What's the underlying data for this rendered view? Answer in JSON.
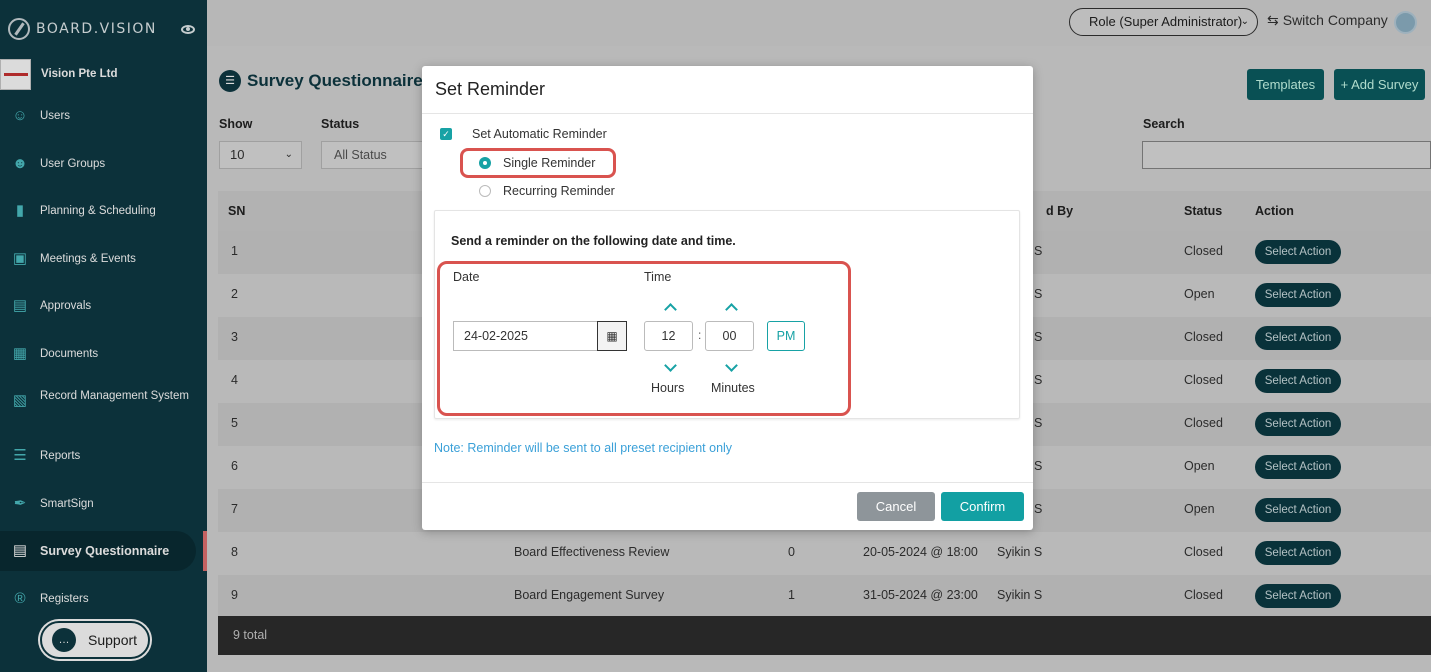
{
  "brand": {
    "name": "BOARD.VISION"
  },
  "company": {
    "name": "Vision Pte Ltd"
  },
  "sidebar": {
    "items": [
      {
        "label": "Users",
        "icon": "user-icon"
      },
      {
        "label": "User Groups",
        "icon": "user-group-icon"
      },
      {
        "label": "Planning & Scheduling",
        "icon": "chart-bars-icon"
      },
      {
        "label": "Meetings & Events",
        "icon": "calendar-icon"
      },
      {
        "label": "Approvals",
        "icon": "approval-doc-icon"
      },
      {
        "label": "Documents",
        "icon": "documents-icon"
      },
      {
        "label": "Record Management System",
        "icon": "record-icon"
      },
      {
        "label": "Reports",
        "icon": "reports-icon"
      },
      {
        "label": "SmartSign",
        "icon": "signature-icon"
      },
      {
        "label": "Survey Questionnaire",
        "icon": "survey-icon",
        "active": true
      },
      {
        "label": "Registers",
        "icon": "registered-icon"
      }
    ],
    "support_label": "Support"
  },
  "header": {
    "role": "Role (Super Administrator)",
    "switch_company": "Switch Company"
  },
  "main": {
    "title": "Survey Questionnaire",
    "templates_label": "Templates",
    "add_label": "+ Add Survey",
    "show_label": "Show",
    "show_value": "10",
    "status_label": "Status",
    "status_value": "All Status",
    "search_label": "Search",
    "columns": {
      "sn": "SN",
      "by": "d By",
      "status": "Status",
      "action": "Action"
    },
    "rows": [
      {
        "sn": "1",
        "name": "",
        "responses": "",
        "date": "",
        "by": "S",
        "status": "Closed"
      },
      {
        "sn": "2",
        "name": "",
        "responses": "",
        "date": "",
        "by": "S",
        "status": "Open"
      },
      {
        "sn": "3",
        "name": "",
        "responses": "",
        "date": "",
        "by": "S",
        "status": "Closed"
      },
      {
        "sn": "4",
        "name": "",
        "responses": "",
        "date": "",
        "by": "S",
        "status": "Closed"
      },
      {
        "sn": "5",
        "name": "",
        "responses": "",
        "date": "",
        "by": "S",
        "status": "Closed"
      },
      {
        "sn": "6",
        "name": "",
        "responses": "",
        "date": "",
        "by": "S",
        "status": "Open"
      },
      {
        "sn": "7",
        "name": "",
        "responses": "",
        "date": "",
        "by": "S",
        "status": "Open"
      },
      {
        "sn": "8",
        "name": "Board Effectiveness Review",
        "responses": "0",
        "date": "20-05-2024 @ 18:00",
        "by": "Syikin S",
        "status": "Closed"
      },
      {
        "sn": "9",
        "name": "Board Engagement Survey",
        "responses": "1",
        "date": "31-05-2024 @ 23:00",
        "by": "Syikin S",
        "status": "Closed"
      }
    ],
    "action_label": "Select Action",
    "total": "9 total"
  },
  "modal": {
    "title": "Set Reminder",
    "auto_reminder_label": "Set Automatic Reminder",
    "single_label": "Single Reminder",
    "recurring_label": "Recurring Reminder",
    "card_title": "Send a reminder on the following date and time.",
    "date_label": "Date",
    "time_label": "Time",
    "date_value": "24-02-2025",
    "hours_value": "12",
    "minutes_value": "00",
    "ampm": "PM",
    "hours_caption": "Hours",
    "minutes_caption": "Minutes",
    "note": "Note: Reminder will be sent to all preset recipient only",
    "cancel_label": "Cancel",
    "confirm_label": "Confirm"
  },
  "colors": {
    "sidebar": "#0e3a44",
    "accent": "#17a2a5",
    "highlight": "#d9534f",
    "note": "#3aa0d8"
  }
}
